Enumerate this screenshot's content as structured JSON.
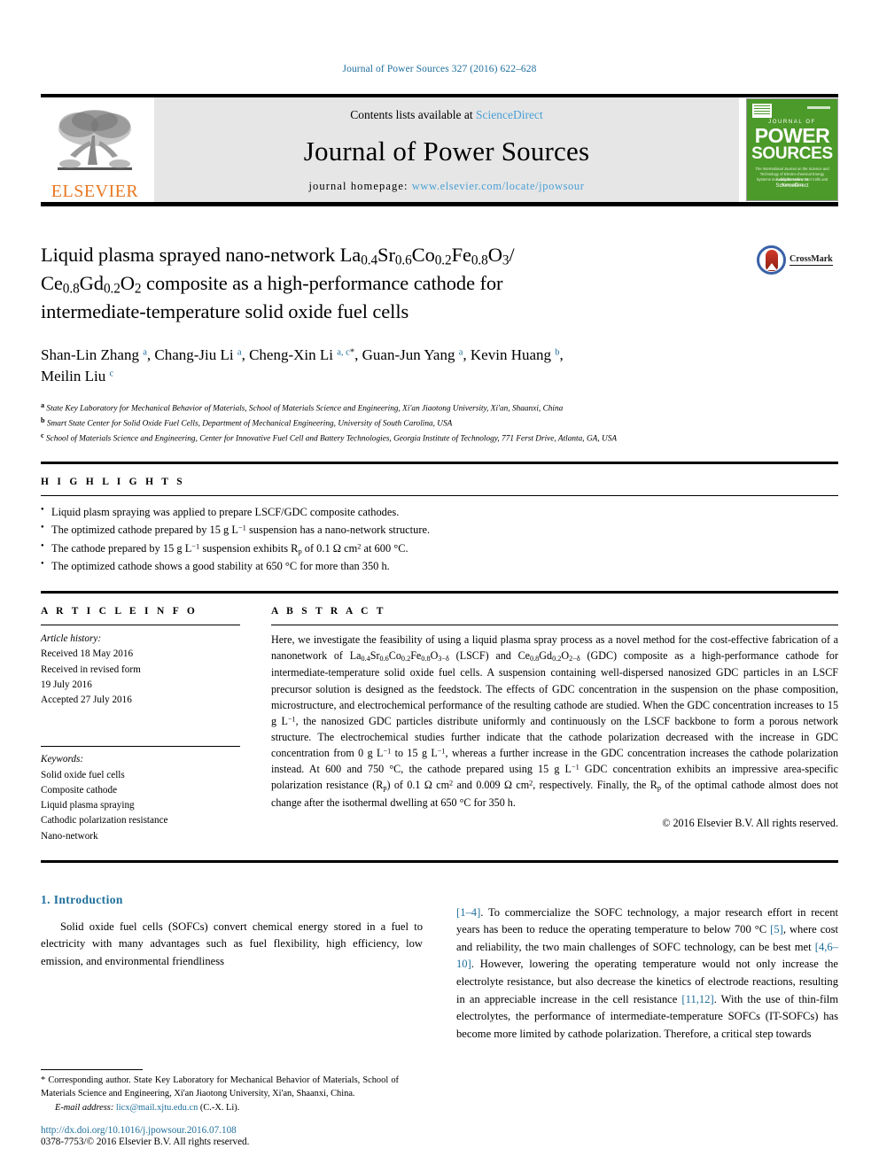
{
  "running_head": "Journal of Power Sources 327 (2016) 622–628",
  "masthead": {
    "publisher_logo_text": "ELSEVIER",
    "contents_prefix": "Contents lists available at ",
    "sciencedirect": "ScienceDirect",
    "journal_name": "Journal of Power Sources",
    "homepage_prefix": "journal homepage: ",
    "homepage_url": "www.elsevier.com/locate/jpowsour",
    "cover": {
      "journal_of": "JOURNAL OF",
      "power": "POWER",
      "sources": "SOURCES",
      "blurb": "The International Journal on the Science and Technology of Electro-chemical Energy Systems including Batteries, Fuel Cells and Photovoltaics",
      "bottom_small": "Available online at",
      "bottom_big": "ScienceDirect"
    }
  },
  "title": {
    "line1_a": "Liquid plasma sprayed nano-network La",
    "line1_sub1": "0.4",
    "line1_b": "Sr",
    "line1_sub2": "0.6",
    "line1_c": "Co",
    "line1_sub3": "0.2",
    "line1_d": "Fe",
    "line1_sub4": "0.8",
    "line1_e": "O",
    "line1_sub5": "3",
    "line1_f": "/",
    "line2_a": "Ce",
    "line2_sub1": "0.8",
    "line2_b": "Gd",
    "line2_sub2": "0.2",
    "line2_c": "O",
    "line2_sub3": "2",
    "line2_d": " composite as a high-performance cathode for",
    "line3": "intermediate-temperature solid oxide fuel cells",
    "crossmark_label": "CrossMark"
  },
  "authors": [
    {
      "name": "Shan-Lin Zhang",
      "marks": "a",
      "corr": false
    },
    {
      "name": "Chang-Jiu Li",
      "marks": "a",
      "corr": false
    },
    {
      "name": "Cheng-Xin Li",
      "marks": "a, c",
      "corr": true
    },
    {
      "name": "Guan-Jun Yang",
      "marks": "a",
      "corr": false
    },
    {
      "name": "Kevin Huang",
      "marks": "b",
      "corr": false
    },
    {
      "name": "Meilin Liu",
      "marks": "c",
      "corr": false
    }
  ],
  "affiliations": [
    {
      "label": "a",
      "text": "State Key Laboratory for Mechanical Behavior of Materials, School of Materials Science and Engineering, Xi'an Jiaotong University, Xi'an, Shaanxi, China"
    },
    {
      "label": "b",
      "text": "Smart State Center for Solid Oxide Fuel Cells, Department of Mechanical Engineering, University of South Carolina, USA"
    },
    {
      "label": "c",
      "text": "School of Materials Science and Engineering, Center for Innovative Fuel Cell and Battery Technologies, Georgia Institute of Technology, 771 Ferst Drive, Atlanta, GA, USA"
    }
  ],
  "highlights": {
    "heading": "H I G H L I G H T S",
    "items": [
      {
        "pre": "Liquid plasm spraying was applied to prepare LSCF/GDC composite cathodes."
      },
      {
        "pre": "The optimized cathode prepared by 15 g L",
        "sup": "−1",
        "post": " suspension has a nano-network structure."
      },
      {
        "pre": "The cathode prepared by 15 g L",
        "sup": "−1",
        "post": " suspension exhibits Rp of 0.1 Ω cm2 at 600 °C."
      },
      {
        "pre": "The optimized cathode shows a good stability at 650 °C for more than 350 h."
      }
    ]
  },
  "article_info": {
    "heading": "A R T I C L E   I N F O",
    "history_title": "Article history:",
    "history": [
      "Received 18 May 2016",
      "Received in revised form",
      "19 July 2016",
      "Accepted 27 July 2016"
    ],
    "keywords_title": "Keywords:",
    "keywords": [
      "Solid oxide fuel cells",
      "Composite cathode",
      "Liquid plasma spraying",
      "Cathodic polarization resistance",
      "Nano-network"
    ]
  },
  "abstract": {
    "heading": "A B S T R A C T",
    "copyright": "© 2016 Elsevier B.V. All rights reserved."
  },
  "introduction": {
    "section_number": "1.",
    "section_title": "Introduction",
    "left_paragraph": "Solid oxide fuel cells (SOFCs) convert chemical energy stored in a fuel to electricity with many advantages such as fuel flexibility, high efficiency, low emission, and environmental friendliness"
  },
  "footnote": {
    "corr_text": "* Corresponding author. State Key Laboratory for Mechanical Behavior of Materials, School of Materials Science and Engineering, Xi'an Jiaotong University, Xi'an, Shaanxi, China.",
    "email_label": "E-mail address:",
    "email": "licx@mail.xjtu.edu.cn",
    "email_owner": "(C.-X. Li).",
    "doi": "http://dx.doi.org/10.1016/j.jpowsour.2016.07.108",
    "issn": "0378-7753/© 2016 Elsevier B.V. All rights reserved."
  },
  "colors": {
    "link": "#1f6f9c",
    "sciencedirect": "#4a9fd4",
    "elsevier_orange": "#e87722",
    "cover_green": "#4c9a2a",
    "crossmark_blue": "#3a62a8",
    "crossmark_red": "#b22a16"
  }
}
